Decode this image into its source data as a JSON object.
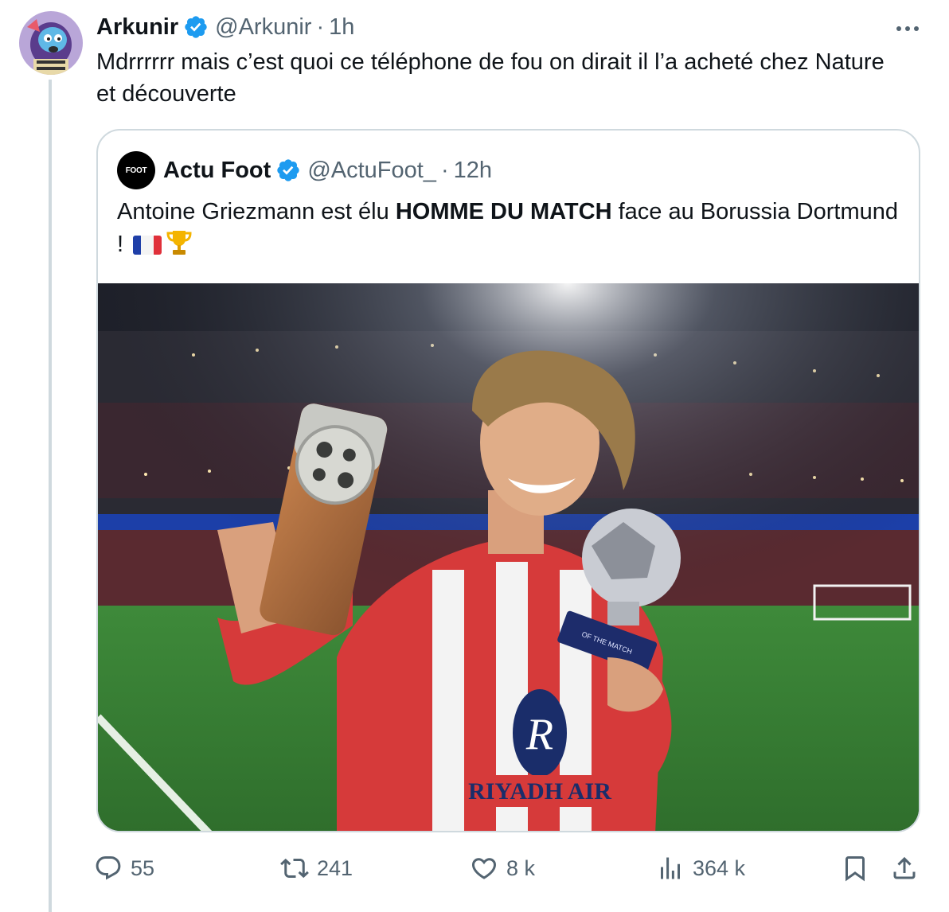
{
  "tweet": {
    "author_name": "Arkunir",
    "author_handle": "@Arkunir",
    "time": "1h",
    "text": "Mdrrrrrr mais c’est quoi ce téléphone de fou on dirait il l’a acheté chez Nature et découverte"
  },
  "quote": {
    "avatar_text": "FOOT",
    "author_name": "Actu Foot",
    "author_handle": "@ActuFoot_",
    "time": "12h",
    "text_before": "Antoine Griezmann est élu ",
    "text_bold": "HOMME DU MATCH",
    "text_after": " face au Borussia Dortmund ! ",
    "photo": {
      "sponsor_text": "RIYADH AIR",
      "trophy_text": "OF THE MATCH"
    }
  },
  "actions": {
    "replies": "55",
    "retweets": "241",
    "likes": "8 k",
    "views": "364 k"
  },
  "colors": {
    "text": "#0f1419",
    "muted": "#536471",
    "border": "#cfd9de",
    "verified": "#1d9bf0"
  },
  "icons": [
    "more-icon",
    "verified-badge-icon",
    "reply-icon",
    "retweet-icon",
    "like-icon",
    "views-icon",
    "bookmark-icon",
    "share-icon"
  ]
}
